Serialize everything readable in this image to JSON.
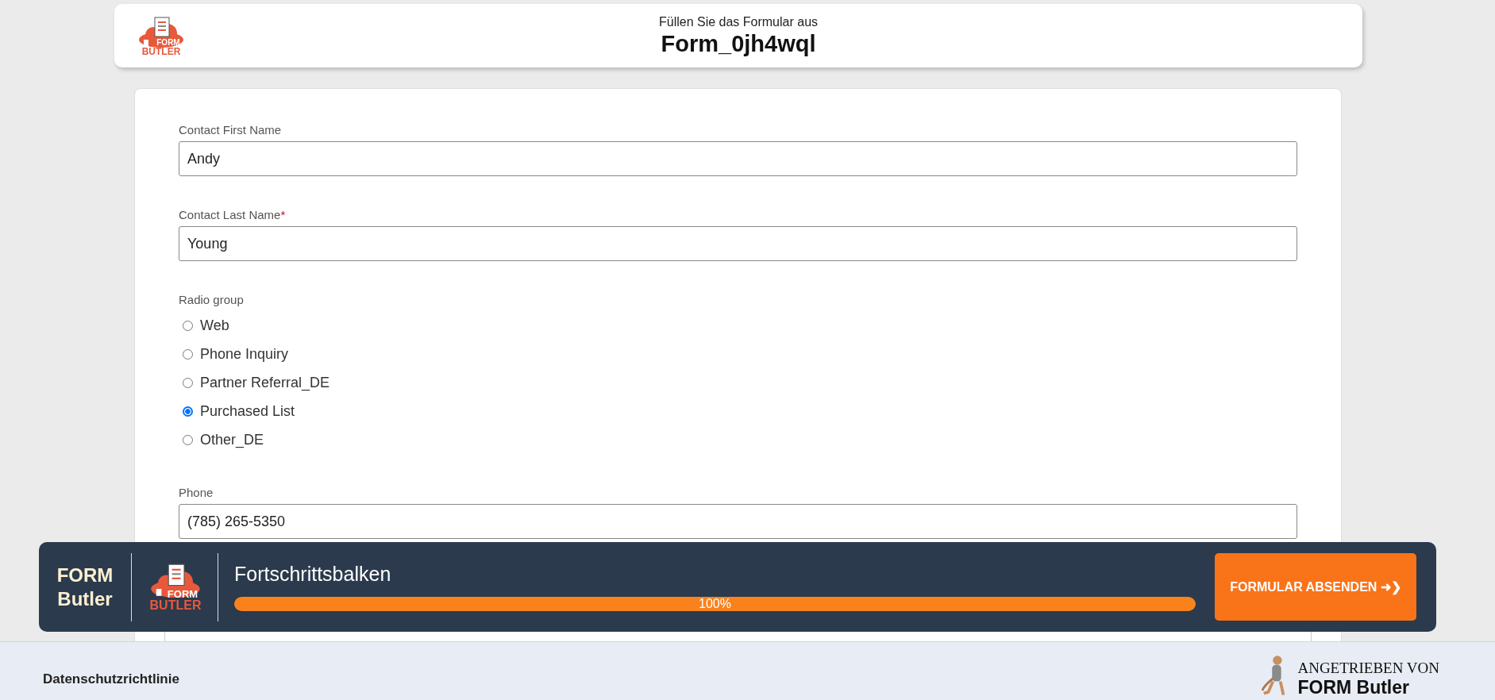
{
  "header": {
    "logo": {
      "line_1": "FORM",
      "line_2": "BUTLER"
    },
    "subtitle": "Füllen Sie das Formular aus",
    "title": "Form_0jh4wql"
  },
  "form": {
    "fields": [
      {
        "kind": "text",
        "label": "Contact First Name",
        "value": "Andy"
      },
      {
        "kind": "text",
        "label": "Contact Last Name",
        "required_mark": "*",
        "value": "Young"
      },
      {
        "kind": "radio",
        "label": "Radio group",
        "options": [
          {
            "label": "Web",
            "selected": false
          },
          {
            "label": "Phone Inquiry",
            "selected": false
          },
          {
            "label": "Partner Referral_DE",
            "selected": false
          },
          {
            "label": "Purchased List",
            "selected": true
          },
          {
            "label": "Other_DE",
            "selected": false
          }
        ]
      },
      {
        "kind": "text",
        "label": "Phone",
        "value": "(785) 265-5350"
      }
    ]
  },
  "progress_bar": {
    "brand_line_1": "FORM",
    "brand_line_2": "Butler",
    "logo": {
      "line_1": "FORM",
      "line_2": "BUTLER"
    },
    "title": "Fortschrittsbalken",
    "level": 1.0,
    "reading": "100%",
    "submit_button": "FORMULAR ABSENDEN ➜❯"
  },
  "footer": {
    "privacy_link": "Datenschutzrichtlinie",
    "powered_by": "ANGETRIEBEN VON",
    "brand": "FORM Butler"
  }
}
